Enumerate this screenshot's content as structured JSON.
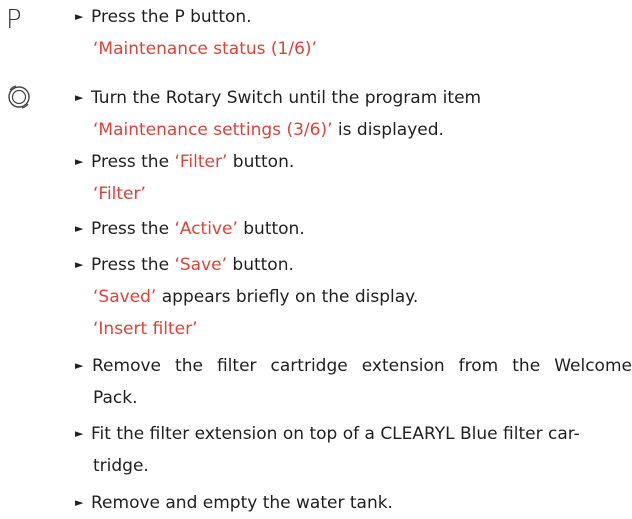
{
  "icons": {
    "p_button": "P",
    "rotary": "rotary-switch-icon"
  },
  "steps": {
    "s1": {
      "text": "Press the P button."
    },
    "s1_display": "‘Maintenance status (1/6)’",
    "s2": {
      "text": "Turn the Rotary Switch until the program item"
    },
    "s2_display": "‘Maintenance settings (3/6)’",
    "s2_suffix": " is displayed.",
    "s3": {
      "pre": "Press the ",
      "red": "‘Filter’",
      "post": " button."
    },
    "s3_display": "‘Filter’",
    "s4": {
      "pre": "Press the ",
      "red": "‘Active’",
      "post": " button."
    },
    "s5": {
      "pre": "Press the ",
      "red": "‘Save’",
      "post": " button."
    },
    "s5_saved": "‘Saved’",
    "s5_saved_suffix": " appears briefly on the display.",
    "s5_display": "‘Insert filter’",
    "s6": {
      "w1": "Remove",
      "w2": "the",
      "w3": "filter",
      "w4": "cartridge",
      "w5": "extension",
      "w6": "from",
      "w7": "the",
      "w8": "Welcome",
      "line2": "Pack."
    },
    "s7": {
      "line1": "Fit the filter extension on top of a CLEARYL Blue filter car-",
      "line2": "tridge."
    },
    "s8": {
      "text": "Remove and empty the water tank."
    }
  }
}
